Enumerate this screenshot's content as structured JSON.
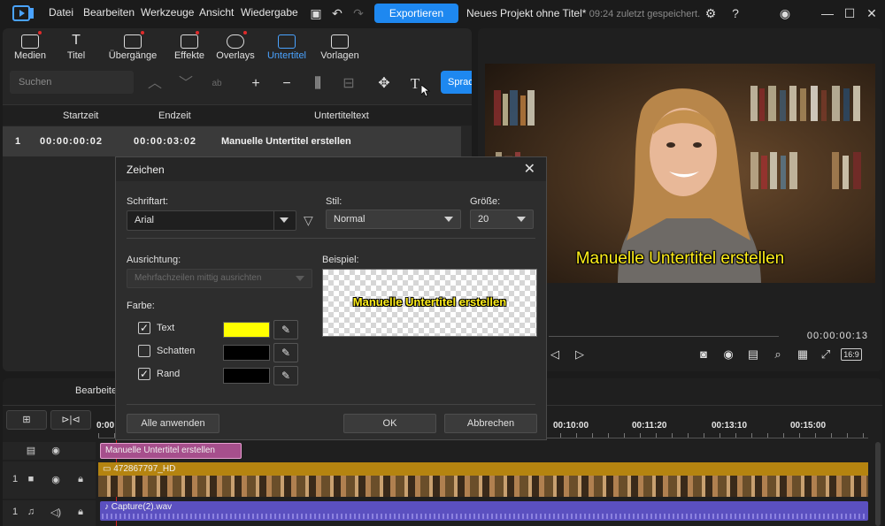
{
  "menu": {
    "items": [
      "Datei",
      "Bearbeiten",
      "Werkzeuge",
      "Ansicht",
      "Wiedergabe"
    ],
    "export_label": "Exportieren",
    "project_title": "Neues Projekt ohne Titel*",
    "project_saved": "09:24 zuletzt gespeichert."
  },
  "tabs": [
    {
      "label": "Medien"
    },
    {
      "label": "Titel"
    },
    {
      "label": "Übergänge"
    },
    {
      "label": "Effekte"
    },
    {
      "label": "Overlays"
    },
    {
      "label": "Untertitel"
    },
    {
      "label": "Vorlagen"
    }
  ],
  "toolbar": {
    "search_placeholder": "Suchen",
    "sprache_label": "Sprac"
  },
  "subtitle_table": {
    "headers": [
      "Startzeit",
      "Endzeit",
      "Untertiteltext"
    ],
    "rows": [
      {
        "index": "1",
        "start": "00:00:00:02",
        "end": "00:00:03:02",
        "text": "Manuelle Untertitel erstellen"
      }
    ]
  },
  "preview": {
    "subtitle": "Manuelle Untertitel erstellen",
    "timecode": "00:00:00:13",
    "aspect": "16:9"
  },
  "dialog": {
    "title": "Zeichen",
    "font_label": "Schriftart:",
    "font_value": "Arial",
    "style_label": "Stil:",
    "style_value": "Normal",
    "size_label": "Größe:",
    "size_value": "20",
    "alignment_label": "Ausrichtung:",
    "alignment_value": "Mehrfachzeilen mittig ausrichten",
    "sample_label": "Beispiel:",
    "sample_text": "Manuelle Untertitel erstellen",
    "color_label": "Farbe:",
    "colors": [
      {
        "label": "Text",
        "checked": true,
        "color": "#ffff00"
      },
      {
        "label": "Schatten",
        "checked": false,
        "color": "#000000"
      },
      {
        "label": "Rand",
        "checked": true,
        "color": "#000000"
      }
    ],
    "apply_all_label": "Alle anwenden",
    "ok_label": "OK",
    "cancel_label": "Abbrechen"
  },
  "timeline": {
    "edit_label": "Bearbeite",
    "ruler": [
      "0:00",
      "00:10:00",
      "00:11:20",
      "00:13:10",
      "00:15:00"
    ],
    "subtitle_clip": "Manuelle Untertitel erstellen",
    "video_clip": "472867797_HD",
    "audio_clip": "Capture(2).wav",
    "track_numbers": [
      "1",
      "1"
    ]
  },
  "colors": {
    "accent": "#1e88f0",
    "subtitle_yellow": "#ffef1a",
    "video_track": "#b8860b",
    "audio_track": "#6a5acd",
    "subtitle_clip": "#c060a0"
  }
}
